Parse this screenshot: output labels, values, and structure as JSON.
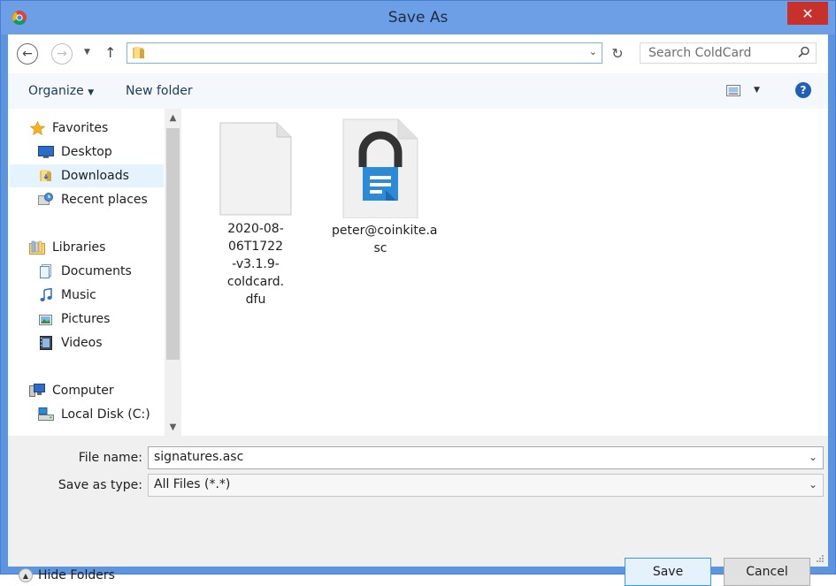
{
  "window": {
    "title": "Save As"
  },
  "navigation": {
    "address_value": "",
    "search_placeholder": "Search ColdCard"
  },
  "toolbar": {
    "organize_label": "Organize",
    "new_folder_label": "New folder"
  },
  "sidebar": {
    "items": [
      {
        "label": "Favorites",
        "icon": "star-icon",
        "type": "group"
      },
      {
        "label": "Desktop",
        "icon": "desktop-icon",
        "type": "item"
      },
      {
        "label": "Downloads",
        "icon": "downloads-folder-icon",
        "type": "item",
        "selected": true
      },
      {
        "label": "Recent places",
        "icon": "recent-places-icon",
        "type": "item"
      },
      {
        "label": "Libraries",
        "icon": "libraries-icon",
        "type": "group"
      },
      {
        "label": "Documents",
        "icon": "documents-icon",
        "type": "item"
      },
      {
        "label": "Music",
        "icon": "music-icon",
        "type": "item"
      },
      {
        "label": "Pictures",
        "icon": "pictures-icon",
        "type": "item"
      },
      {
        "label": "Videos",
        "icon": "videos-icon",
        "type": "item"
      },
      {
        "label": "Computer",
        "icon": "computer-icon",
        "type": "group"
      },
      {
        "label": "Local Disk (C:)",
        "icon": "local-disk-icon",
        "type": "item"
      }
    ]
  },
  "files": [
    {
      "name_lines": [
        "2020-08-06T1722",
        "-v3.1.9-coldcard.",
        "dfu"
      ],
      "icon": "blank-file-icon"
    },
    {
      "name_lines": [
        "peter@coinkite.a",
        "sc"
      ],
      "icon": "signed-document-icon"
    }
  ],
  "form": {
    "file_name_label": "File name:",
    "file_name_value": "signatures.asc",
    "save_type_label": "Save as type:",
    "save_type_value": "All Files (*.*)"
  },
  "footer": {
    "hide_folders_label": "Hide Folders",
    "save_label": "Save",
    "cancel_label": "Cancel"
  },
  "colors": {
    "titlebar": "#6d9fe6",
    "close_button": "#c7302b",
    "accent": "#3399ff",
    "selected_item": "#e5f3ff"
  }
}
